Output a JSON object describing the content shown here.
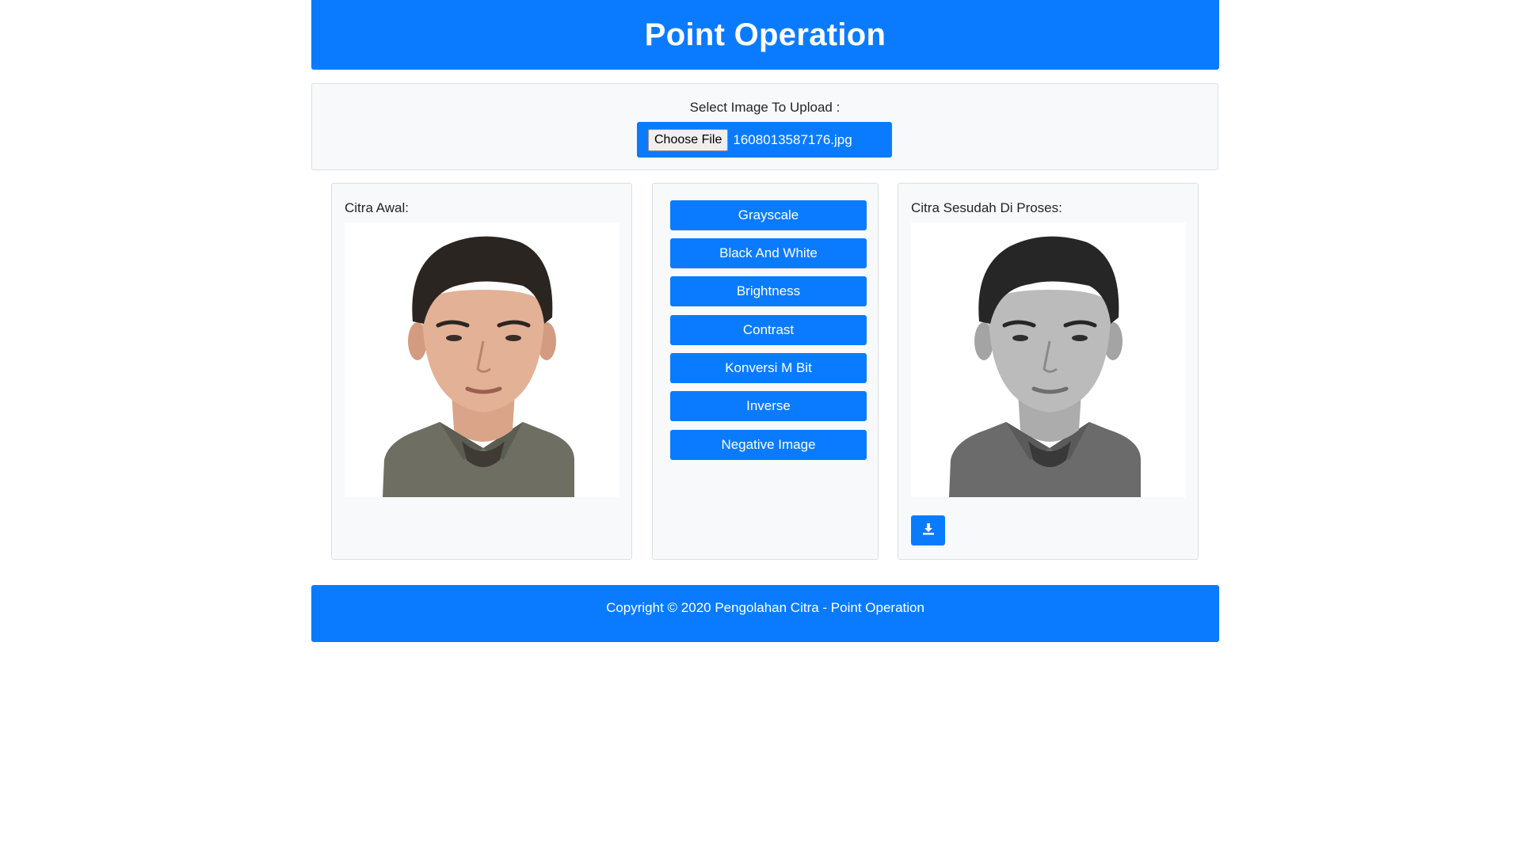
{
  "header": {
    "title": "Point Operation"
  },
  "upload": {
    "label": "Select Image To Upload :",
    "choose_button": "Choose File",
    "file_name": "1608013587176.jpg"
  },
  "original": {
    "title": "Citra Awal:"
  },
  "operations": {
    "buttons": [
      "Grayscale",
      "Black And White",
      "Brightness",
      "Contrast",
      "Konversi M Bit",
      "Inverse",
      "Negative Image"
    ]
  },
  "processed": {
    "title": "Citra Sesudah Di Proses:",
    "download_icon": "download-icon"
  },
  "footer": {
    "text": "Copyright © 2020 Pengolahan Citra - Point Operation"
  },
  "colors": {
    "primary": "#0a7bff",
    "panel": "#f8f9fa",
    "border": "#dcdfe3"
  }
}
